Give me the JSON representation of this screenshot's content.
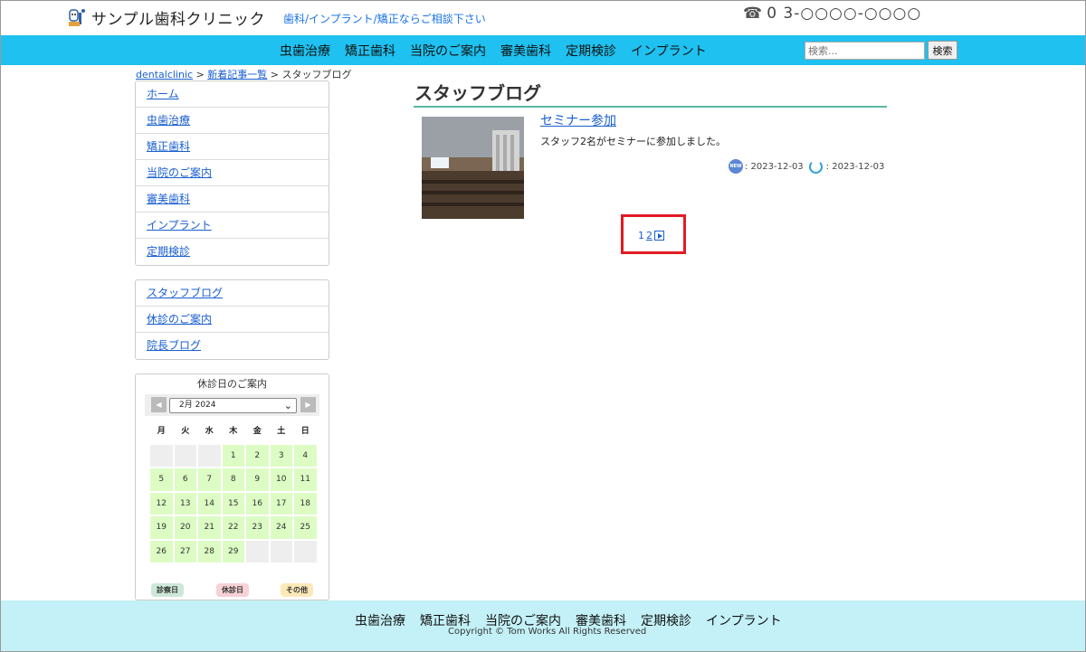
{
  "header": {
    "logo_icon": "tooth-character-icon",
    "site_title": "サンプル歯科クリニック",
    "tagline": "歯科/インプラント/矯正ならご相談下さい",
    "phone_icon": "telephone-icon",
    "phone": "0 3-○○○○-○○○○"
  },
  "nav": {
    "items": [
      "虫歯治療",
      "矯正歯科",
      "当院のご案内",
      "審美歯科",
      "定期検診",
      "インプラント"
    ],
    "search_placeholder": "検索...",
    "search_button": "検索"
  },
  "breadcrumb": {
    "home": "dentalclinic",
    "sep1": " > ",
    "list": "新着記事一覧",
    "sep2": " > ",
    "current": "スタッフブログ"
  },
  "sidebar": {
    "menu1": [
      "ホーム",
      "虫歯治療",
      "矯正歯科",
      "当院のご案内",
      "審美歯科",
      "インプラント",
      "定期検診"
    ],
    "menu2": [
      "スタッフブログ",
      "休診のご案内",
      "院長ブログ"
    ]
  },
  "calendar": {
    "title": "休診日のご案内",
    "month_label": "2月 2024",
    "weekdays": [
      "月",
      "火",
      "水",
      "木",
      "金",
      "土",
      "日"
    ],
    "leading_blanks": 3,
    "days_in_month": 29,
    "legend": [
      "診察日",
      "休診日",
      "その他"
    ],
    "colors": {
      "open": "#dcfcc4",
      "closed": "#f6d1d6",
      "other": "#fde9b8"
    }
  },
  "main": {
    "title": "スタッフブログ",
    "post": {
      "title": "セミナー参加",
      "excerpt": "スタッフ2名がセミナーに参加しました。",
      "new_icon_label": "NEW",
      "published": ": 2023-12-03",
      "updated": ": 2023-12-03"
    },
    "pager": {
      "current": "1",
      "next": "2"
    }
  },
  "footer": {
    "nav": [
      "虫歯治療",
      "矯正歯科",
      "当院のご案内",
      "審美歯科",
      "定期検診",
      "インプラント"
    ],
    "copyright": "Copyright © Tom Works All Rights Reserved"
  },
  "colors": {
    "nav_bg": "#1ec1ef",
    "footer_bg": "#c3f1f7",
    "title_rule": "#5cb9a3",
    "highlight": "#e21b23"
  }
}
